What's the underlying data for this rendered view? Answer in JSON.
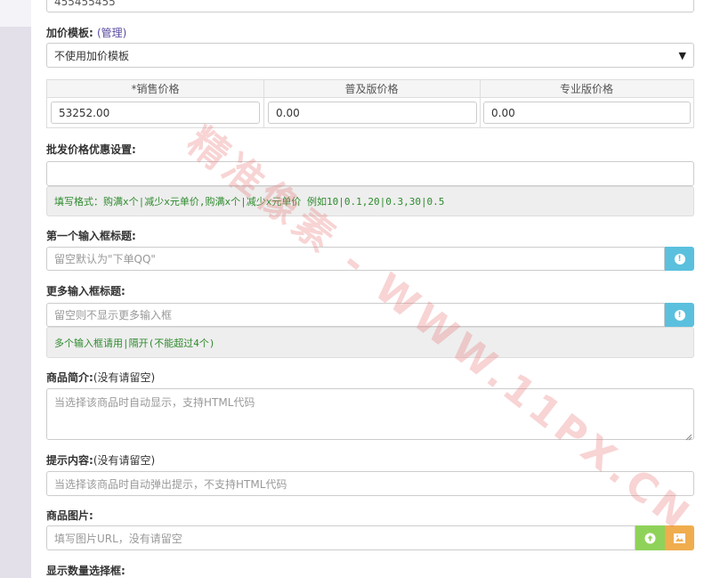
{
  "top_field": {
    "value": "455455455"
  },
  "markup_template": {
    "label": "加价模板:",
    "manage_link": "(管理)",
    "selected": "不使用加价模板",
    "arrow": "▼"
  },
  "price_table": {
    "headers": [
      "*销售价格",
      "普及版价格",
      "专业版价格"
    ],
    "values": [
      "53252.00",
      "0.00",
      "0.00"
    ]
  },
  "bulk_discount": {
    "label": "批发价格优惠设置:",
    "value": "",
    "hint": "填写格式：购满x个|减少x元单价,购满x个|减少x元单价  例如10|0.1,20|0.3,30|0.5"
  },
  "first_input_title": {
    "label": "第一个输入框标题:",
    "placeholder": "留空默认为\"下单QQ\"",
    "info_icon": "info-icon"
  },
  "more_input_title": {
    "label": "更多输入框标题:",
    "placeholder": "留空则不显示更多输入框",
    "info_icon": "info-icon",
    "hint": "多个输入框请用|隔开(不能超过4个)"
  },
  "product_intro": {
    "label": "商品简介:",
    "label_note": "(没有请留空)",
    "placeholder": "当选择该商品时自动显示，支持HTML代码"
  },
  "tip_content": {
    "label": "提示内容:",
    "label_note": "(没有请留空)",
    "placeholder": "当选择该商品时自动弹出提示，不支持HTML代码"
  },
  "product_image": {
    "label": "商品图片:",
    "placeholder": "填写图片URL，没有请留空",
    "upload_icon": "upload-icon",
    "gallery_icon": "image-icon"
  },
  "quantity_selector": {
    "label": "显示数量选择框:"
  },
  "watermark": {
    "text": "精准像素 - WWW.11PX.CN"
  },
  "colors": {
    "info_button": "#5bc0de",
    "upload_button": "#8fd25a",
    "gallery_button": "#f0ad4e",
    "hint_text": "#2e8b2e",
    "link": "#5a4aa0"
  }
}
